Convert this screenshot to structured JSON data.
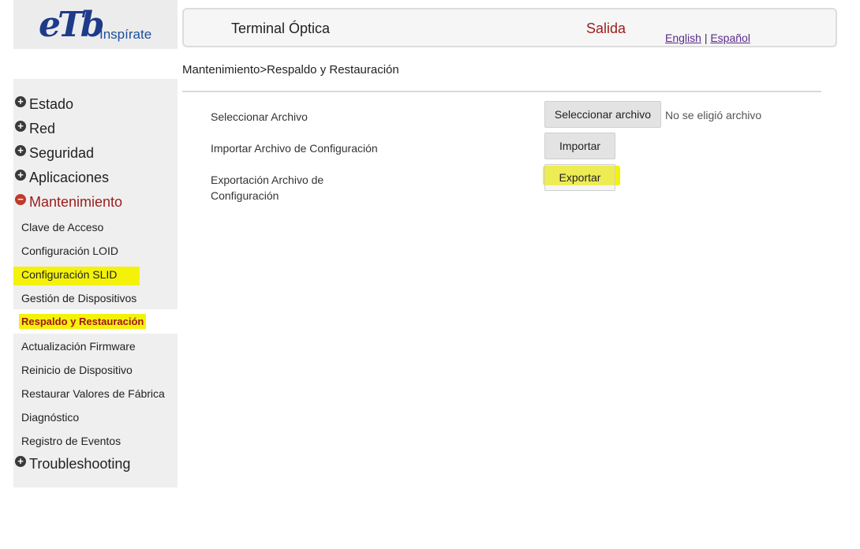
{
  "brand": {
    "logo_text": "eTb",
    "tagline": "Inspírate",
    "color": "#1e3a8a"
  },
  "header": {
    "title": "Terminal Óptica",
    "exit_label": "Salida",
    "lang_english": "English",
    "lang_separator": "|",
    "lang_spanish": "Español"
  },
  "breadcrumb": "Mantenimiento>Respaldo y Restauración",
  "sidebar": {
    "items": [
      {
        "label": "Estado",
        "icon": "plus-circle-icon"
      },
      {
        "label": "Red",
        "icon": "plus-circle-icon"
      },
      {
        "label": "Seguridad",
        "icon": "plus-circle-icon"
      },
      {
        "label": "Aplicaciones",
        "icon": "plus-circle-icon"
      },
      {
        "label": "Mantenimiento",
        "icon": "minus-circle-icon",
        "expanded": true
      },
      {
        "label": "Troubleshooting",
        "icon": "plus-circle-icon"
      }
    ],
    "submenu": [
      "Clave de Acceso",
      "Configuración LOID",
      "Configuración SLID",
      "Gestión de Dispositivos",
      "Respaldo y Restauración",
      "Actualización Firmware",
      "Reinicio de Dispositivo",
      "Restaurar Valores de Fábrica",
      "Diagnóstico",
      "Registro de Eventos"
    ],
    "active_submenu": "Respaldo y Restauración"
  },
  "content": {
    "select_label": "Seleccionar Archivo",
    "select_button": "Seleccionar archivo",
    "file_status": "No se eligió archivo",
    "import_label": "Importar Archivo de Configuración",
    "import_button": "Importar",
    "export_label_line1": "Exportación Archivo de",
    "export_label_line2": "Configuración",
    "export_button": "Exportar"
  },
  "colors": {
    "highlight": "#f5f20a",
    "exit": "#9b1c1c",
    "active_menu": "#c0392b"
  }
}
